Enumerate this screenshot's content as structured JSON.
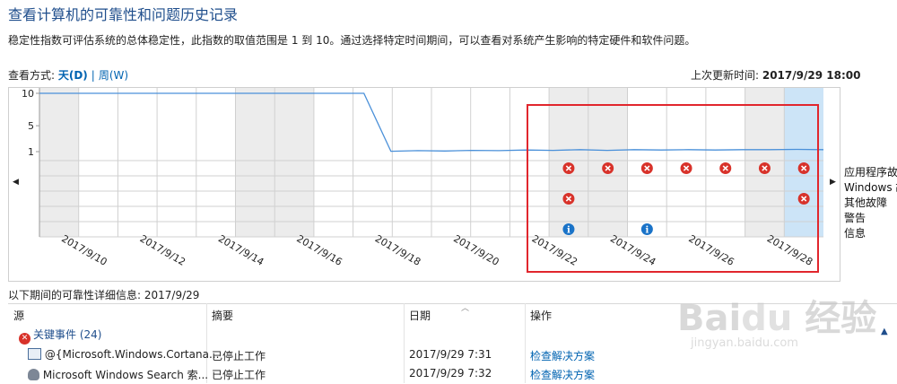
{
  "page": {
    "title": "查看计算机的可靠性和问题历史记录",
    "description": "稳定性指数可评估系统的总体稳定性，此指数的取值范围是 1 到 10。通过选择特定时间期间，可以查看对系统产生影响的特定硬件和软件问题。"
  },
  "view_mode": {
    "label": "查看方式: ",
    "day": "天(D)",
    "separator": "|",
    "week": "周(W)",
    "selected": "day"
  },
  "last_updated": {
    "label": "上次更新时间: ",
    "value": "2017/9/29 18:00"
  },
  "chart_data": {
    "type": "line",
    "y_ticks": [
      "10",
      "5",
      "1"
    ],
    "ylim": [
      1,
      10
    ],
    "x_labels": [
      "2017/9/10",
      "2017/9/12",
      "2017/9/14",
      "2017/9/16",
      "2017/9/18",
      "2017/9/20",
      "2017/9/22",
      "2017/9/24",
      "2017/9/26",
      "2017/9/28"
    ],
    "series": [
      {
        "values": [
          10,
          10,
          10,
          10,
          10,
          10,
          10,
          10,
          10,
          10,
          10,
          10,
          10,
          1.05,
          1.15,
          1.1,
          1.2,
          1.15,
          1.25,
          1.2,
          1.3,
          1.2,
          1.3,
          1.25,
          1.3,
          1.25,
          1.3,
          1.3,
          1.35,
          1.3
        ]
      }
    ],
    "selected_column": 19,
    "shaded_columns": [
      0,
      5,
      6,
      13,
      14,
      18,
      19
    ],
    "event_rows": [
      "应用程序故障",
      "Windows 故障",
      "其他故障",
      "警告",
      "信息"
    ],
    "events": [
      {
        "row": "应用程序故障",
        "type": "error",
        "columns": [
          13,
          14,
          15,
          16,
          17,
          18,
          19
        ]
      },
      {
        "row": "其他故障",
        "type": "error",
        "columns": [
          13,
          19
        ]
      },
      {
        "row": "信息",
        "type": "info",
        "columns": [
          13,
          15
        ]
      }
    ],
    "grid": true
  },
  "details": {
    "title": "以下期间的可靠性详细信息: 2017/9/29",
    "columns": [
      "源",
      "摘要",
      "日期",
      "操作"
    ],
    "group": {
      "label": "关键事件 (24)"
    },
    "rows": [
      {
        "source": "@{Microsoft.Windows.Cortana...",
        "summary": "已停止工作",
        "date": "2017/9/29 7:31",
        "action": "检查解决方案",
        "icon": "app-window-icon"
      },
      {
        "source": "Microsoft Windows Search 索...",
        "summary": "已停止工作",
        "date": "2017/9/29 7:32",
        "action": "检查解决方案",
        "icon": "service-user-icon"
      }
    ]
  },
  "watermark": {
    "logo": "Bai du 经验",
    "url": "jingyan.baidu.com"
  },
  "colors": {
    "line": "#4a90d9",
    "shaded": "#ececec",
    "selected": "#cce4f7",
    "grid": "#d0d0d0",
    "error": "#d8322a",
    "info": "#1a73c8",
    "highlight": "#e1262d",
    "link": "#0063b1"
  }
}
